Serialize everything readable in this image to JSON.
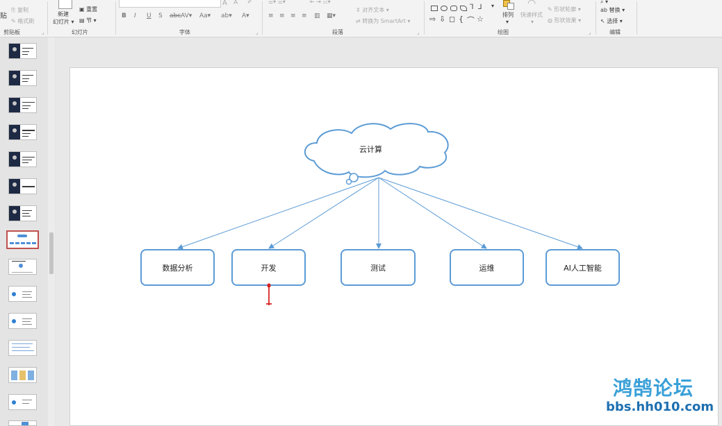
{
  "ribbon": {
    "clipboard": {
      "paste": "贴",
      "copy": "复制",
      "format_painter": "格式刷",
      "label": "剪贴板"
    },
    "slides": {
      "new_slide": "新建",
      "new_slide2": "幻灯片",
      "reset": "重置",
      "section": "节",
      "label": "幻灯片"
    },
    "font": {
      "label": "字体",
      "bold": "B",
      "italic": "I",
      "underline": "U",
      "strike": "S",
      "spacing": "AV",
      "case": "Aa",
      "color": "A"
    },
    "paragraph": {
      "align_text": "对齐文本",
      "convert_smartart": "转换为 SmartArt",
      "label": "段落"
    },
    "drawing": {
      "arrange": "排列",
      "quick_styles": "快速样式",
      "shape_outline": "形状轮廓",
      "shape_effects": "形状效果",
      "label": "绘图"
    },
    "editing": {
      "replace": "替换",
      "select": "选择",
      "label": "编辑"
    }
  },
  "slide": {
    "cloud_label": "云计算",
    "boxes": [
      "数据分析",
      "开发",
      "测试",
      "运维",
      "AI人工智能"
    ]
  },
  "watermark": {
    "title": "鸿鹄论坛",
    "url": "bbs.hh010.com"
  },
  "colors": {
    "accent": "#5b9bd5",
    "selected_thumb": "#c0504d"
  }
}
